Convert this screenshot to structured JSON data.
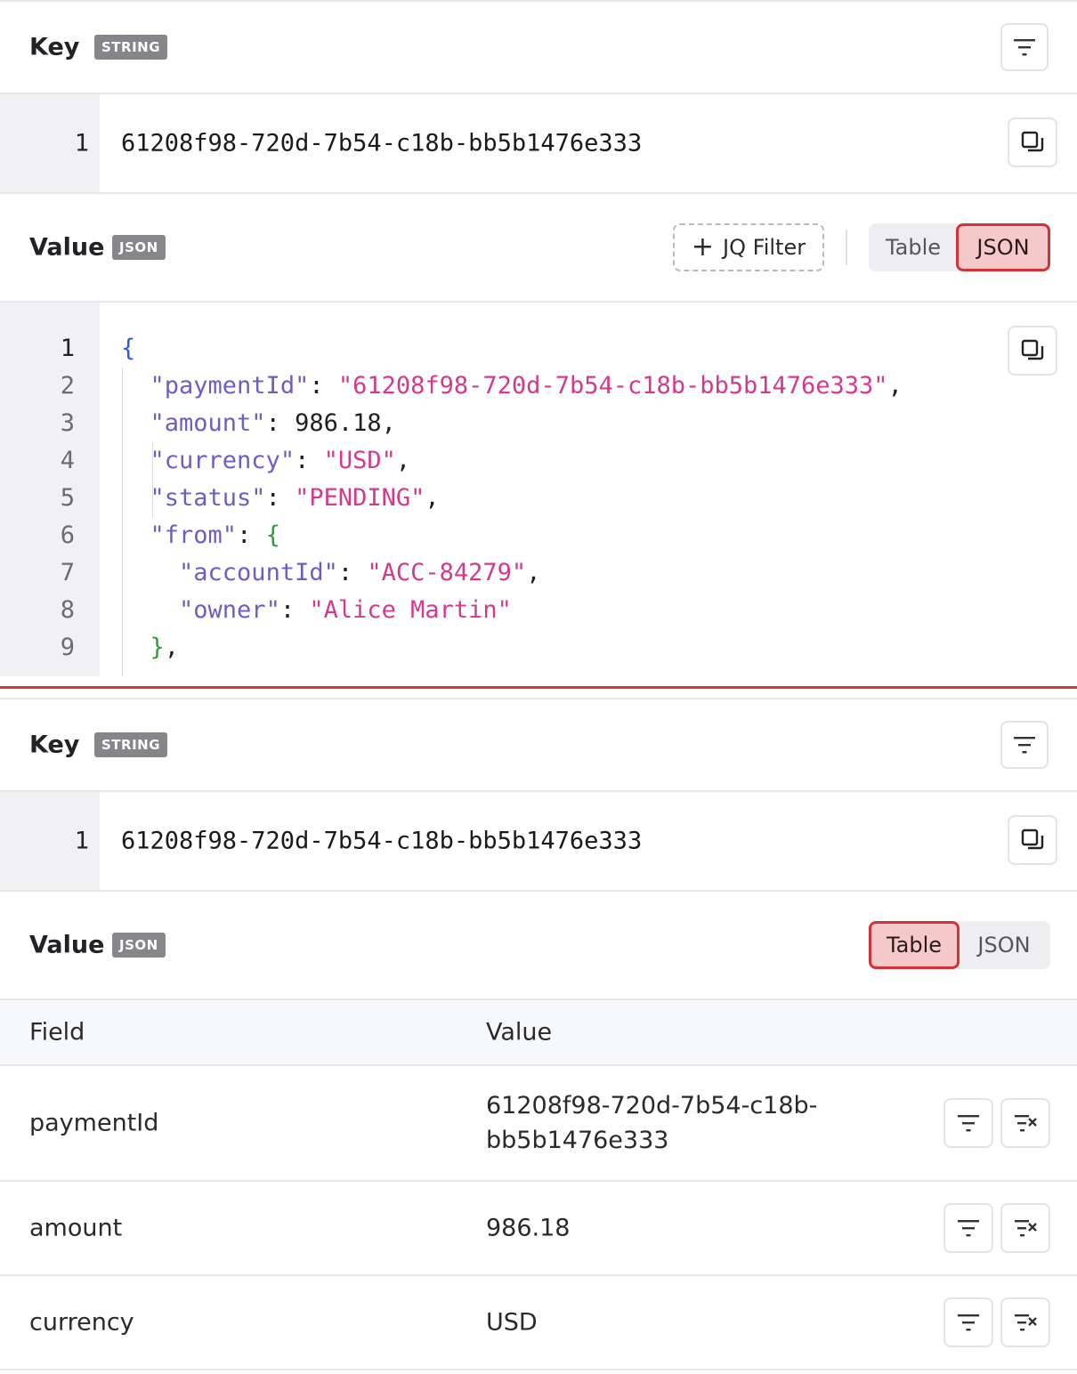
{
  "panel_a": {
    "key_section": {
      "title": "Key",
      "type_tag": "STRING",
      "line_number": "1",
      "value": "61208f98-720d-7b54-c18b-bb5b1476e333"
    },
    "value_section": {
      "title": "Value",
      "type_tag": "JSON",
      "jq_filter_label": "JQ Filter",
      "toggle": {
        "table_label": "Table",
        "json_label": "JSON",
        "active": "JSON"
      }
    },
    "code": {
      "line_numbers": [
        "1",
        "2",
        "3",
        "4",
        "5",
        "6",
        "7",
        "8",
        "9"
      ],
      "lines": [
        "{",
        "  \"paymentId\": \"61208f98-720d-7b54-c18b-bb5b1476e333\",",
        "  \"amount\": 986.18,",
        "  \"currency\": \"USD\",",
        "  \"status\": \"PENDING\",",
        "  \"from\": {",
        "    \"accountId\": \"ACC-84279\",",
        "    \"owner\": \"Alice Martin\"",
        "  },"
      ]
    }
  },
  "panel_b": {
    "key_section": {
      "title": "Key",
      "type_tag": "STRING",
      "line_number": "1",
      "value": "61208f98-720d-7b54-c18b-bb5b1476e333"
    },
    "value_section": {
      "title": "Value",
      "type_tag": "JSON",
      "toggle": {
        "table_label": "Table",
        "json_label": "JSON",
        "active": "Table"
      }
    },
    "table": {
      "headers": {
        "field": "Field",
        "value": "Value"
      },
      "rows": [
        {
          "field": "paymentId",
          "value_line1": "61208f98-720d-7b54-c18b-",
          "value_line2": "bb5b1476e333"
        },
        {
          "field": "amount",
          "value": "986.18"
        },
        {
          "field": "currency",
          "value": "USD"
        }
      ]
    }
  },
  "colors": {
    "accent_red": "#d0333a",
    "active_fill": "#f5c9c9",
    "json_key": "#6b5fc4",
    "json_string": "#d33a8f",
    "brace_outer": "#2a5bd7",
    "brace_inner": "#2f9a3a"
  },
  "icons": [
    "filter-icon",
    "copy-icon",
    "plus-icon",
    "filter-exclude-icon"
  ]
}
